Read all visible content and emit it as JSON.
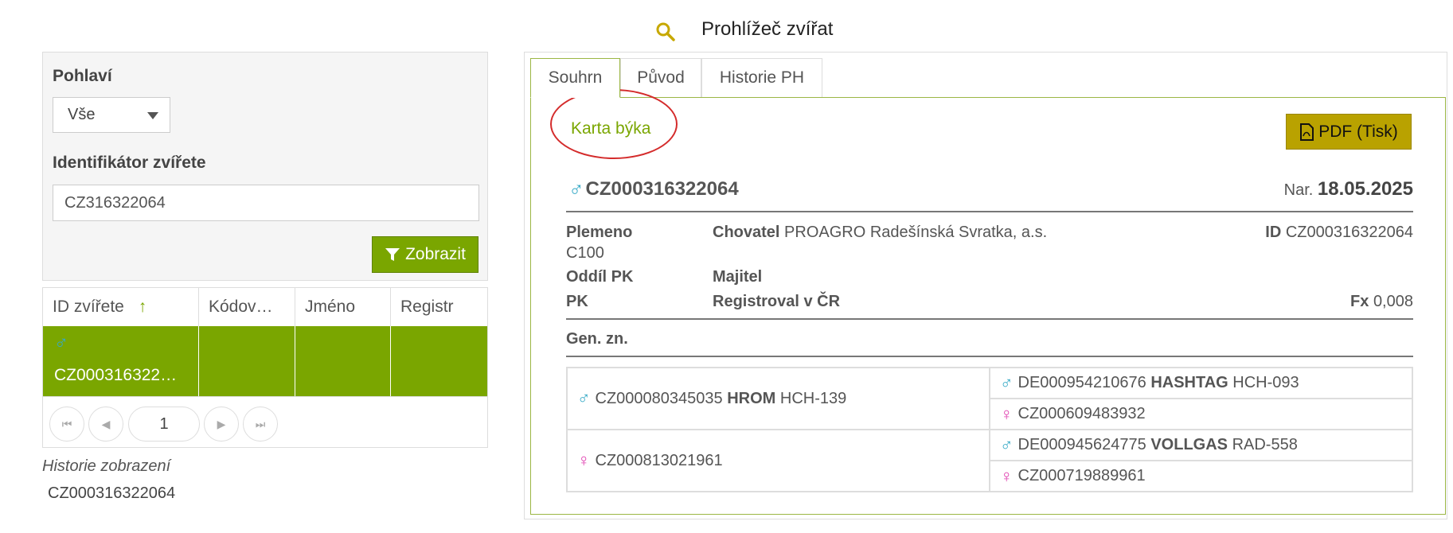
{
  "header": {
    "title": "Prohlížeč zvířat",
    "icon": "search-icon"
  },
  "filters": {
    "sex_label": "Pohlaví",
    "sex_value": "Vše",
    "id_label": "Identifikátor zvířete",
    "id_value": "CZ316322064",
    "show_button": "Zobrazit"
  },
  "grid": {
    "columns": [
      "ID zvířete",
      "Kódov…",
      "Jméno",
      "Registr"
    ],
    "sorted_column": "ID zvířete",
    "rows": [
      {
        "id": "CZ000316322…",
        "sex_symbol": "♂"
      }
    ],
    "page": "1"
  },
  "history": {
    "title": "Historie zobrazení",
    "items": [
      "CZ000316322064"
    ]
  },
  "tabs": [
    "Souhrn",
    "Původ",
    "Historie PH"
  ],
  "active_tab": "Souhrn",
  "card": {
    "link": "Karta býka",
    "pdf_button": "PDF (Tisk)",
    "animal_id": "CZ000316322064",
    "birth_label": "Nar.",
    "birth_date": "18.05.2025",
    "plemeno_label": "Plemeno",
    "plemeno_value": "C100",
    "chovatel_label": "Chovatel",
    "chovatel_value": "PROAGRO Radešínská Svratka, a.s.",
    "id_label": "ID",
    "id_value": "CZ000316322064",
    "oddil_label": "Oddíl PK",
    "majitel_label": "Majitel",
    "pk_label": "PK",
    "registroval_label": "Registroval v ČR",
    "fx_label": "Fx",
    "fx_value": "0,008",
    "gen_label": "Gen. zn."
  },
  "pedigree": {
    "sire": {
      "sex": "♂",
      "id": "CZ000080345035",
      "name": "HROM",
      "code": "HCH-139"
    },
    "dam": {
      "sex": "♀",
      "id": "CZ000813021961"
    },
    "sire_sire": {
      "sex": "♂",
      "id": "DE000954210676",
      "name": "HASHTAG",
      "code": "HCH-093"
    },
    "sire_dam": {
      "sex": "♀",
      "id": "CZ000609483932"
    },
    "dam_sire": {
      "sex": "♂",
      "id": "DE000945624775",
      "name": "VOLLGAS",
      "code": "RAD-558"
    },
    "dam_dam": {
      "sex": "♀",
      "id": "CZ000719889961"
    }
  },
  "colors": {
    "accent_green": "#7aa600",
    "pdf_button": "#b9a200",
    "male": "#35a9c6",
    "female": "#e040b0",
    "highlight_ring": "#d42b2b"
  }
}
